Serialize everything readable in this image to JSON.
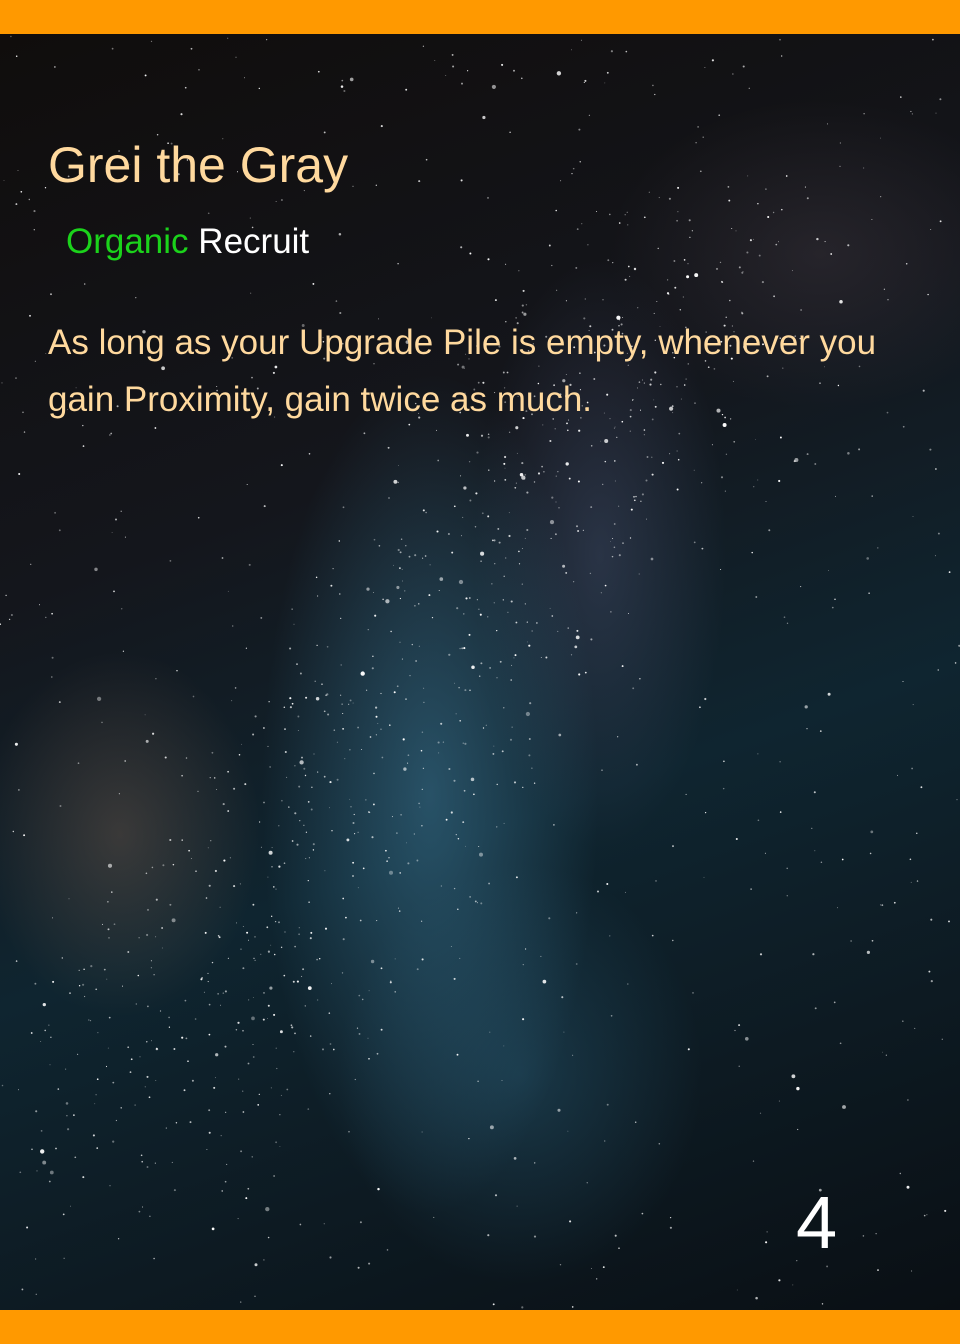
{
  "card": {
    "name": "Grei the Gray",
    "faction": "Organic",
    "type": "Recruit",
    "ability": "As long as your Upgrade Pile is empty, whenever you gain Proximity, gain twice as much.",
    "cost": "4"
  },
  "colors": {
    "band": "#ff9900",
    "name_text": "#ffd99e",
    "faction_text": "#1bd31b",
    "type_text": "#ffffff",
    "ability_text": "#ffd99e",
    "cost_text": "#ffffff"
  }
}
